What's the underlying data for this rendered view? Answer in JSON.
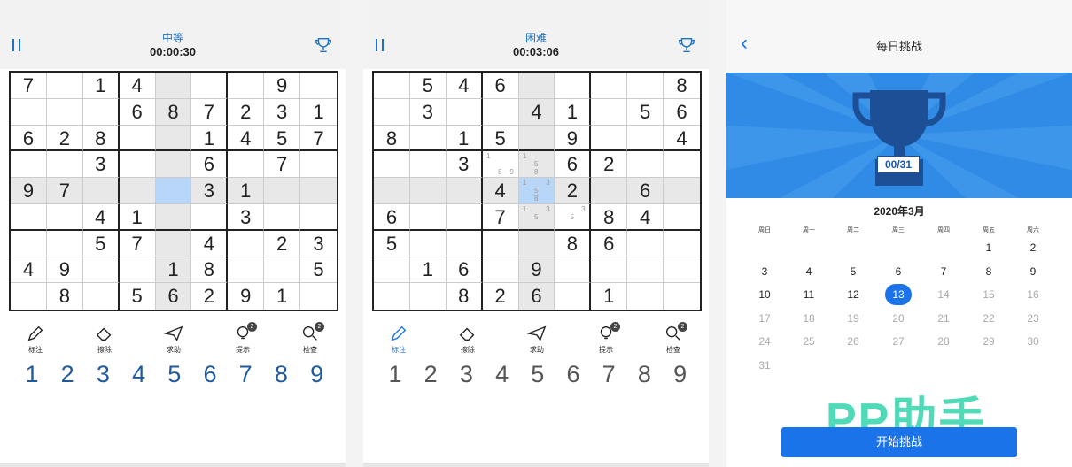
{
  "panel1": {
    "difficulty": "中等",
    "timer": "00:00:30",
    "grid": [
      [
        "7",
        "",
        "1",
        "4",
        "",
        "",
        "",
        "9",
        ""
      ],
      [
        "",
        "",
        "",
        "6",
        "8",
        "7",
        "2",
        "3",
        "1"
      ],
      [
        "6",
        "2",
        "8",
        "",
        "",
        "1",
        "4",
        "5",
        "7"
      ],
      [
        "",
        "",
        "3",
        "",
        "",
        "6",
        "",
        "7",
        ""
      ],
      [
        "9",
        "7",
        "",
        "",
        "",
        "3",
        "1",
        "",
        ""
      ],
      [
        "",
        "",
        "4",
        "1",
        "",
        "",
        "3",
        "",
        ""
      ],
      [
        "",
        "",
        "5",
        "7",
        "",
        "4",
        "",
        "2",
        "3"
      ],
      [
        "4",
        "9",
        "",
        "",
        "1",
        "8",
        "",
        "",
        "5"
      ],
      [
        "",
        "8",
        "",
        "5",
        "6",
        "2",
        "9",
        "1",
        ""
      ]
    ]
  },
  "panel2": {
    "difficulty": "困难",
    "timer": "00:03:06",
    "grid": [
      [
        "",
        "5",
        "4",
        "6",
        "",
        "",
        "",
        "",
        "8"
      ],
      [
        "",
        "3",
        "",
        "",
        "4",
        "1",
        "",
        "5",
        "6"
      ],
      [
        "8",
        "",
        "1",
        "5",
        "",
        "9",
        "",
        "",
        "4"
      ],
      [
        "",
        "",
        "3",
        "",
        "",
        "6",
        "2",
        "",
        ""
      ],
      [
        "",
        "",
        "",
        "4",
        "",
        "2",
        "",
        "6",
        ""
      ],
      [
        "6",
        "",
        "",
        "7",
        "",
        "",
        "8",
        "4",
        ""
      ],
      [
        "5",
        "",
        "",
        "",
        "",
        "8",
        "6",
        "",
        ""
      ],
      [
        "",
        "1",
        "6",
        "",
        "9",
        "",
        "",
        "",
        ""
      ],
      [
        "",
        "",
        "8",
        "2",
        "6",
        "",
        "1",
        "",
        ""
      ]
    ],
    "notes": {
      "3-3": [
        "1",
        "",
        "",
        "",
        "",
        "",
        "",
        "8",
        "9"
      ],
      "3-4": [
        "1",
        "",
        "",
        "",
        "5",
        "",
        "",
        "8",
        ""
      ],
      "4-4": [
        "1",
        "",
        "3",
        "",
        "5",
        "",
        "",
        "8",
        ""
      ],
      "5-4": [
        "1",
        "",
        "3",
        "",
        "5",
        "",
        "",
        "",
        ""
      ],
      "5-5": [
        "",
        "",
        "3",
        "",
        "5",
        "",
        "",
        "",
        ""
      ]
    }
  },
  "tools": {
    "mark": "标注",
    "erase": "擦除",
    "help": "求助",
    "hint": "提示",
    "check": "检查",
    "hint_badge": "2",
    "check_badge": "2"
  },
  "numbers": [
    "1",
    "2",
    "3",
    "4",
    "5",
    "6",
    "7",
    "8",
    "9"
  ],
  "daily": {
    "title": "每日挑战",
    "back_icon": "chevron-left-icon",
    "progress": "00/31",
    "month": "2020年3月",
    "weekdays": [
      "周日",
      "周一",
      "周二",
      "周三",
      "周四",
      "周五",
      "周六"
    ],
    "days": [
      "1",
      "2",
      "3",
      "4",
      "5",
      "6",
      "7",
      "8",
      "9",
      "10",
      "11",
      "12",
      "13",
      "14",
      "15",
      "16",
      "17",
      "18",
      "19",
      "20",
      "21",
      "22",
      "23",
      "24",
      "25",
      "26",
      "27",
      "28",
      "29",
      "30",
      "31"
    ],
    "today": "13",
    "first_weekday_index": 5,
    "start_button": "开始挑战",
    "watermark": "PP助手"
  },
  "colors": {
    "accent": "#1a73e8",
    "number_blue": "#1f5a9e",
    "banner": "#2f8be6",
    "watermark": "#3fd7b0"
  }
}
